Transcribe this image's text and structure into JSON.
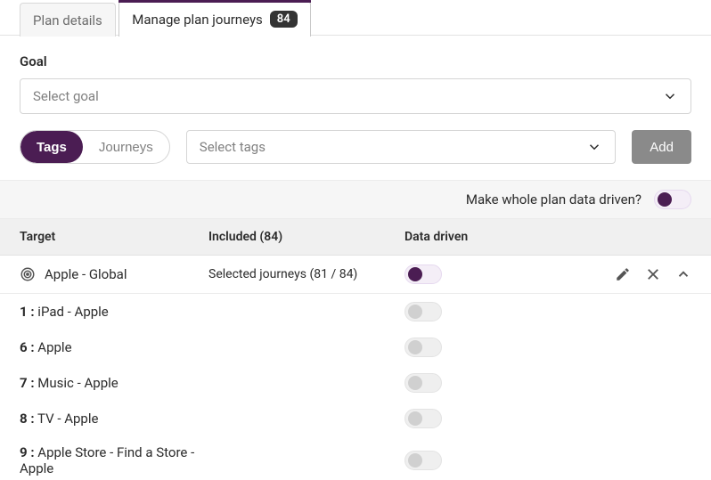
{
  "tabs": {
    "plan_details": "Plan details",
    "manage": "Manage plan journeys",
    "badge": "84"
  },
  "goal": {
    "label": "Goal",
    "placeholder": "Select goal"
  },
  "segment": {
    "tags": "Tags",
    "journeys": "Journeys"
  },
  "tags_placeholder": "Select tags",
  "add_label": "Add",
  "dd_question": "Make whole plan data driven?",
  "columns": {
    "target": "Target",
    "included": "Included (84)",
    "data_driven": "Data driven"
  },
  "group": {
    "name": "Apple - Global",
    "included": "Selected journeys (81 / 84)"
  },
  "rows": [
    {
      "idx": "1 :",
      "name": "iPad - Apple"
    },
    {
      "idx": "6 :",
      "name": "Apple"
    },
    {
      "idx": "7 :",
      "name": "Music - Apple"
    },
    {
      "idx": "8 :",
      "name": "TV - Apple"
    },
    {
      "idx": "9 :",
      "name": "Apple Store - Find a Store - Apple"
    }
  ]
}
